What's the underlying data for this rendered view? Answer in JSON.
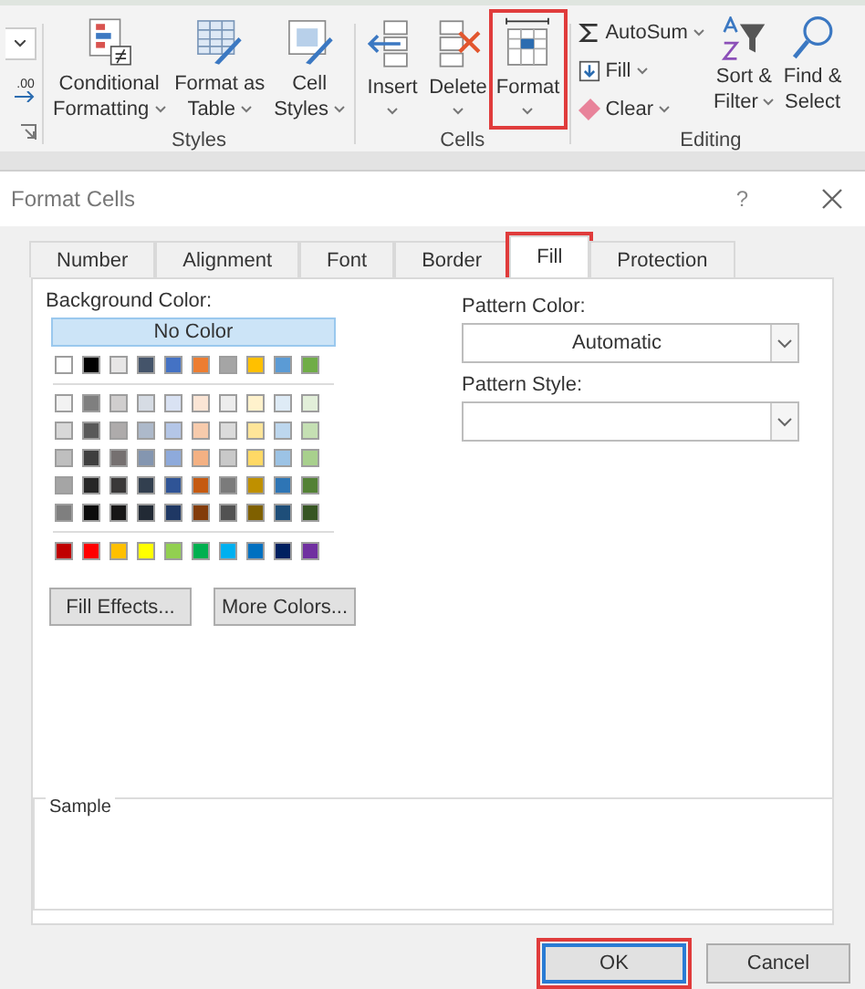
{
  "ribbon": {
    "left_partial": {
      "decimal_label": ".00"
    },
    "groups": [
      {
        "name": "Styles",
        "buttons": [
          {
            "kind": "large",
            "lines": [
              "Conditional",
              "Formatting"
            ],
            "dropdown": true,
            "highlighted": false
          },
          {
            "kind": "large",
            "lines": [
              "Format as",
              "Table"
            ],
            "dropdown": true,
            "highlighted": false
          },
          {
            "kind": "large",
            "lines": [
              "Cell",
              "Styles"
            ],
            "dropdown": true,
            "highlighted": false
          }
        ]
      },
      {
        "name": "Cells",
        "buttons": [
          {
            "kind": "large",
            "lines": [
              "Insert"
            ],
            "dropdown": true,
            "highlighted": false
          },
          {
            "kind": "large",
            "lines": [
              "Delete"
            ],
            "dropdown": true,
            "highlighted": false
          },
          {
            "kind": "large",
            "lines": [
              "Format"
            ],
            "dropdown": true,
            "highlighted": true
          }
        ]
      },
      {
        "name": "Editing",
        "buttons": [
          {
            "kind": "small",
            "lines": [
              "AutoSum"
            ],
            "dropdown": true,
            "highlighted": false
          },
          {
            "kind": "small",
            "lines": [
              "Fill"
            ],
            "dropdown": true,
            "highlighted": false
          },
          {
            "kind": "small",
            "lines": [
              "Clear"
            ],
            "dropdown": true,
            "highlighted": false
          },
          {
            "kind": "large",
            "lines": [
              "Sort &",
              "Filter"
            ],
            "dropdown": true,
            "highlighted": false
          },
          {
            "kind": "large",
            "lines": [
              "Find &",
              "Select"
            ],
            "dropdown": false,
            "highlighted": false
          }
        ]
      }
    ]
  },
  "dialog": {
    "title": "Format Cells",
    "help": "?",
    "tabs": [
      {
        "label": "Number",
        "selected": false,
        "highlighted": false
      },
      {
        "label": "Alignment",
        "selected": false,
        "highlighted": false
      },
      {
        "label": "Font",
        "selected": false,
        "highlighted": false
      },
      {
        "label": "Border",
        "selected": false,
        "highlighted": false
      },
      {
        "label": "Fill",
        "selected": true,
        "highlighted": true
      },
      {
        "label": "Protection",
        "selected": false,
        "highlighted": false
      }
    ],
    "background_color": {
      "label": "Background Color:",
      "no_color": {
        "label": "No Color",
        "selected": true
      },
      "theme_row": [
        {
          "color": "#ffffff"
        },
        {
          "color": "#000000"
        },
        {
          "color": "#e7e6e6"
        },
        {
          "color": "#44546a"
        },
        {
          "color": "#4472c4"
        },
        {
          "color": "#ed7d31"
        },
        {
          "color": "#a5a5a5"
        },
        {
          "color": "#ffc000"
        },
        {
          "color": "#5b9bd5"
        },
        {
          "color": "#70ad47"
        }
      ],
      "tint_rows": [
        [
          {
            "color": "#f2f2f2"
          },
          {
            "color": "#7f7f7f"
          },
          {
            "color": "#d0cece"
          },
          {
            "color": "#d6dce4"
          },
          {
            "color": "#d9e2f3"
          },
          {
            "color": "#fbe5d5"
          },
          {
            "color": "#ededed"
          },
          {
            "color": "#fff2cc"
          },
          {
            "color": "#deebf6"
          },
          {
            "color": "#e2efd9"
          }
        ],
        [
          {
            "color": "#d8d8d8"
          },
          {
            "color": "#595959"
          },
          {
            "color": "#aeabab"
          },
          {
            "color": "#adb9ca"
          },
          {
            "color": "#b4c6e7"
          },
          {
            "color": "#f7cbac"
          },
          {
            "color": "#dbdbdb"
          },
          {
            "color": "#fee599"
          },
          {
            "color": "#bdd7ee"
          },
          {
            "color": "#c5e0b3"
          }
        ],
        [
          {
            "color": "#bfbfbf"
          },
          {
            "color": "#3f3f3f"
          },
          {
            "color": "#757070"
          },
          {
            "color": "#8496b0"
          },
          {
            "color": "#8eaadb"
          },
          {
            "color": "#f4b183"
          },
          {
            "color": "#c9c9c9"
          },
          {
            "color": "#ffd965"
          },
          {
            "color": "#9cc3e5"
          },
          {
            "color": "#a8d08d"
          }
        ],
        [
          {
            "color": "#a5a5a5"
          },
          {
            "color": "#262626"
          },
          {
            "color": "#3a3838"
          },
          {
            "color": "#323f4f"
          },
          {
            "color": "#2f5496"
          },
          {
            "color": "#c55a11"
          },
          {
            "color": "#7b7b7b"
          },
          {
            "color": "#bf9000"
          },
          {
            "color": "#2e75b5"
          },
          {
            "color": "#538135"
          }
        ],
        [
          {
            "color": "#7f7f7f"
          },
          {
            "color": "#0c0c0c"
          },
          {
            "color": "#171616"
          },
          {
            "color": "#222a35"
          },
          {
            "color": "#1f3864"
          },
          {
            "color": "#833c0b"
          },
          {
            "color": "#525252"
          },
          {
            "color": "#7f6000"
          },
          {
            "color": "#1e4e79"
          },
          {
            "color": "#375623"
          }
        ]
      ],
      "standard_row": [
        {
          "color": "#c00000"
        },
        {
          "color": "#ff0000"
        },
        {
          "color": "#ffc000"
        },
        {
          "color": "#ffff00"
        },
        {
          "color": "#92d050"
        },
        {
          "color": "#00b050"
        },
        {
          "color": "#00b0f0"
        },
        {
          "color": "#0070c0"
        },
        {
          "color": "#002060"
        },
        {
          "color": "#7030a0"
        }
      ],
      "buttons": [
        "Fill Effects...",
        "More Colors..."
      ]
    },
    "pattern_color": {
      "label": "Pattern Color:",
      "value": "Automatic"
    },
    "pattern_style": {
      "label": "Pattern Style:"
    },
    "sample": {
      "label": "Sample"
    },
    "buttons": [
      {
        "label": "OK",
        "kind": "default",
        "highlighted": true
      },
      {
        "label": "Cancel",
        "kind": "normal",
        "highlighted": false
      }
    ]
  }
}
